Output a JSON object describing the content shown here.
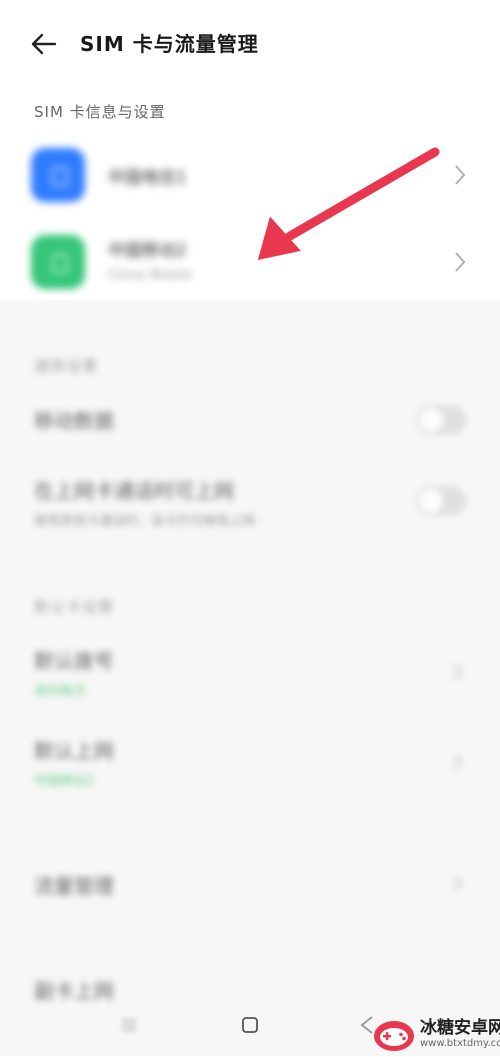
{
  "header": {
    "title": "SIM 卡与流量管理",
    "back_icon": "arrow-left-icon"
  },
  "sim_section": {
    "title": "SIM 卡信息与设置",
    "items": [
      {
        "name": "中国电信1",
        "subtitle": "",
        "icon_color": "#2f7bff",
        "icon": "sim-card-icon"
      },
      {
        "name": "中国移动2",
        "subtitle": "China Mobile",
        "icon_color": "#34c67a",
        "icon": "sim-card-icon"
      }
    ]
  },
  "network_section": {
    "title": "通用设置",
    "rows": [
      {
        "label": "移动数据",
        "subtitle": "",
        "control": "toggle"
      },
      {
        "label": "在上网卡通话时可上网",
        "subtitle": "使用其他卡通话时，该卡仍可继续上网",
        "control": "toggle"
      }
    ]
  },
  "default_section": {
    "title": "默认卡设置",
    "rows": [
      {
        "label": "默认拨号",
        "value": "询问每次",
        "value_color": "#3cbf6a"
      },
      {
        "label": "默认上网",
        "value": "中国移动2",
        "value_color": "#3cbf6a"
      }
    ]
  },
  "more_rows": [
    {
      "label": "流量管理"
    },
    {
      "label": "副卡上网"
    }
  ],
  "annotation": {
    "arrow_color": "#e8374f"
  },
  "watermark": {
    "title": "冰糖安卓网",
    "url": "www.btxtdmy.com",
    "logo_color": "#e8374f"
  }
}
